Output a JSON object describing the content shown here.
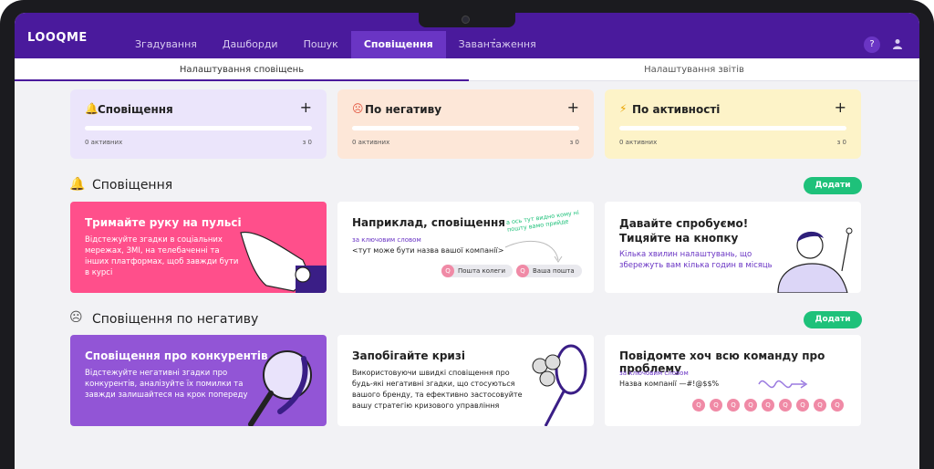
{
  "app": {
    "logo": "LOOQME"
  },
  "nav": {
    "items": [
      "Згадування",
      "Дашборди",
      "Пошук",
      "Сповіщення",
      "Завантаження"
    ],
    "active": "Сповіщення",
    "more": "⋮",
    "help": "?"
  },
  "subtabs": {
    "left": "Налаштування сповіщень",
    "right": "Налаштування звітів"
  },
  "summary_cards": [
    {
      "title": "Сповіщення",
      "icon": "bell-icon",
      "left": "0 активних",
      "right": "з 0",
      "color": "#ebe5fb"
    },
    {
      "title": "По негативу",
      "icon": "sad-face-icon",
      "left": "0 активних",
      "right": "з 0",
      "color": "#fde7d8"
    },
    {
      "title": "По активності",
      "icon": "lightning-icon",
      "left": "0 активних",
      "right": "з 0",
      "color": "#fdf3c8"
    }
  ],
  "section1": {
    "title": "Сповіщення",
    "add": "Додати",
    "card1": {
      "title": "Тримайте руку на пульсі",
      "text": [
        "Відстежуйте згадки в соціальних",
        "мережах, ЗМІ, на телебаченні та",
        "інших платформах, щоб завжди бути",
        "в курсі"
      ]
    },
    "card2": {
      "title": "Наприклад, сповіщення",
      "keyword_label": "за ключовим словом",
      "keyword": "<тут може бути назва вашої компанії>",
      "note": "а ось тут видно кому ні пошту вамо прийде",
      "chip1": "Пошта колеги",
      "chip2": "Ваша пошта"
    },
    "card3": {
      "title": "Давайте спробуємо! Тицяйте на кнопку",
      "text": [
        "Кілька хвилин налаштувань, що",
        "збережуть вам кілька годин в місяць"
      ]
    }
  },
  "section2": {
    "title": "Сповіщення по негативу",
    "add": "Додати",
    "card1": {
      "title": "Сповіщення про конкурентів",
      "text": [
        "Відстежуйте негативні згадки про",
        "конкурентів, аналізуйте їх помилки та",
        "завжди залишайтеся на крок попереду"
      ]
    },
    "card2": {
      "title": "Запобігайте кризі",
      "text": [
        "Використовуючи швидкі сповіщення про",
        "будь-які негативні згадки, що стосуються",
        "вашого бренду, та ефективно застосовуйте",
        "вашу стратегію кризового управління"
      ]
    },
    "card3": {
      "title": "Повідомте хоч всю команду про проблему",
      "keyword_label": "за ключовим словом",
      "keyword": "Назва компанії —#!@$$%"
    }
  },
  "colors": {
    "brand": "#4a1a9c",
    "accent": "#1ec17a",
    "pink": "#ff4f8b",
    "purple": "#9255d6"
  }
}
